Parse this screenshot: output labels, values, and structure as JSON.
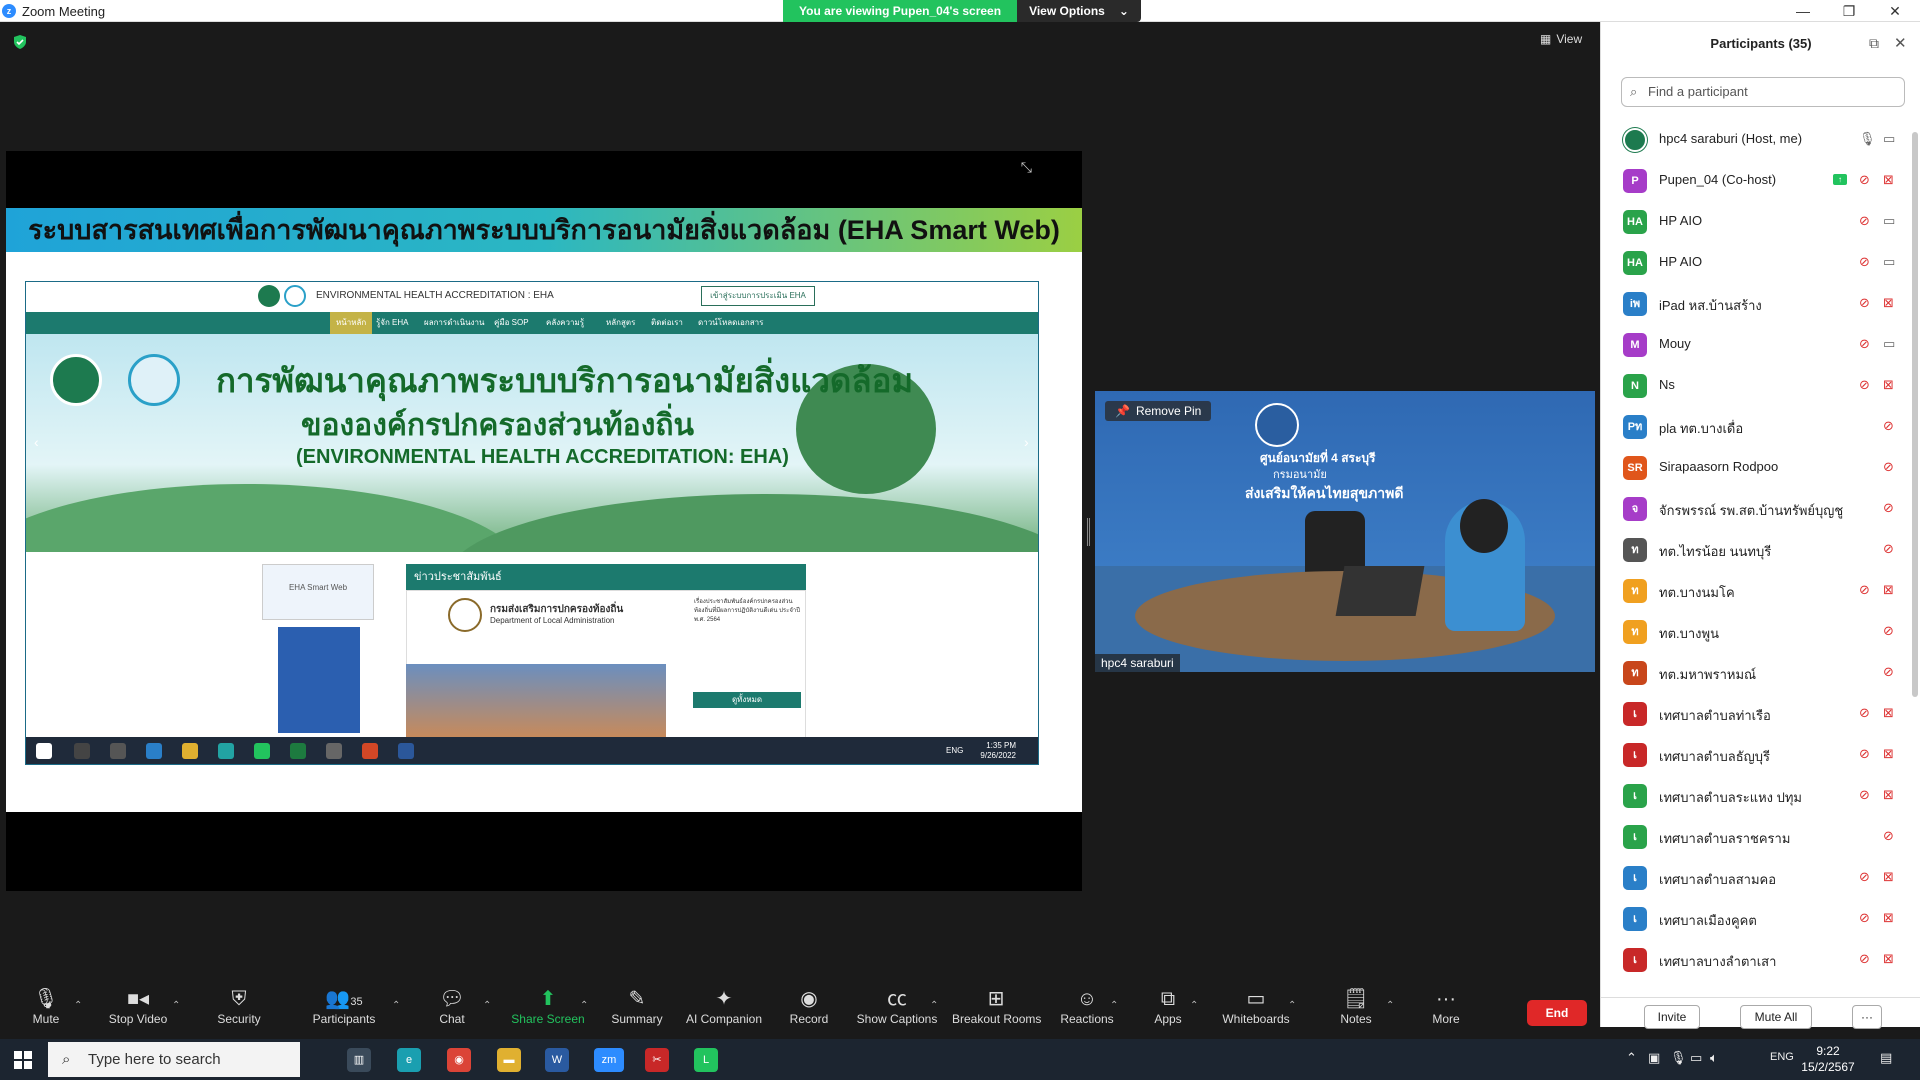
{
  "window": {
    "title": "Zoom Meeting",
    "share_banner": "You are viewing Pupen_04's screen",
    "view_options": "View Options"
  },
  "meeting": {
    "view_label": "View"
  },
  "slide": {
    "title": "ระบบสารสนเทศเพื่อการพัฒนาคุณภาพระบบบริการอนามัยสิ่งแวดล้อม (EHA Smart Web)",
    "site_header": "ENVIRONMENTAL HEALTH ACCREDITATION : EHA",
    "login_button": "เข้าสู่ระบบการประเมิน EHA",
    "nav": [
      "หน้าหลัก",
      "รู้จัก EHA",
      "ผลการดำเนินงาน",
      "คู่มือ SOP",
      "คลังความรู้",
      "หลักสูตร",
      "ติดต่อเรา",
      "ดาวน์โหลดเอกสาร"
    ],
    "banner_line1": "การพัฒนาคุณภาพระบบบริการอนามัยสิ่งแวดล้อม",
    "banner_line2": "ขององค์กรปกครองส่วนท้องถิ่น",
    "banner_line3": "(ENVIRONMENTAL HEALTH ACCREDITATION: EHA)",
    "news_header": "ข่าวประชาสัมพันธ์",
    "news_org_th": "กรมส่งเสริมการปกครองท้องถิ่น",
    "news_org_en": "Department of Local Administration",
    "news_text": "เรื่องประชาสัมพันธ์องค์กรปกครองส่วนท้องถิ่นที่มีผลการปฏิบัติงานดีเด่น ประจำปี พ.ศ. 2564",
    "all_button": "ดูทั้งหมด",
    "eha_smart_web": "EHA Smart Web",
    "taskbar_lang": "ENG",
    "taskbar_time": "1:35 PM",
    "taskbar_date": "9/26/2022"
  },
  "video": {
    "remove_pin": "Remove Pin",
    "name": "hpc4 saraburi",
    "wall_line1": "ศูนย์อนามัยที่ 4 สระบุรี",
    "wall_line2": "กรมอนามัย",
    "wall_line3": "ส่งเสริมให้คนไทยสุขภาพดี"
  },
  "participants": {
    "title": "Participants (35)",
    "search_placeholder": "Find a participant",
    "invite": "Invite",
    "mute_all": "Mute All",
    "more": "···",
    "list": [
      {
        "initials": "",
        "name": "hpc4 saraburi (Host, me)",
        "color": "#1d7a4f",
        "mic": "on",
        "cam": "on"
      },
      {
        "initials": "P",
        "name": "Pupen_04 (Co-host)",
        "color": "#a63cc8",
        "mic": "off",
        "cam": "off",
        "sharing": true
      },
      {
        "initials": "HA",
        "name": "HP AIO",
        "color": "#2aa34a",
        "mic": "off",
        "cam": "on"
      },
      {
        "initials": "HA",
        "name": "HP AIO",
        "color": "#2aa34a",
        "mic": "off",
        "cam": "on"
      },
      {
        "initials": "iพ",
        "name": "iPad หส.บ้านสร้าง",
        "color": "#2a7fc8",
        "mic": "off",
        "cam": "off"
      },
      {
        "initials": "M",
        "name": "Mouy",
        "color": "#a63cc8",
        "mic": "off",
        "cam": "on"
      },
      {
        "initials": "N",
        "name": "Ns",
        "color": "#2aa34a",
        "mic": "off",
        "cam": "off"
      },
      {
        "initials": "Pท",
        "name": "pla ทต.บางเดื่อ",
        "color": "#2a7fc8",
        "mic": "off",
        "cam": ""
      },
      {
        "initials": "SR",
        "name": "Sirapaasorn Rodpoo",
        "color": "#e0561b",
        "mic": "off",
        "cam": ""
      },
      {
        "initials": "จ",
        "name": "จักรพรรณ์ รพ.สต.บ้านทรัพย์บุญชู",
        "color": "#a63cc8",
        "mic": "off",
        "cam": ""
      },
      {
        "initials": "ท",
        "name": "ทต.ไทรน้อย นนทบุรี",
        "color": "#555555",
        "mic": "off",
        "cam": ""
      },
      {
        "initials": "ท",
        "name": "ทต.บางนมโค",
        "color": "#f0a020",
        "mic": "off",
        "cam": "off"
      },
      {
        "initials": "ท",
        "name": "ทต.บางพูน",
        "color": "#f0a020",
        "mic": "off",
        "cam": ""
      },
      {
        "initials": "ท",
        "name": "ทต.มหาพราหมณ์",
        "color": "#c8461b",
        "mic": "off",
        "cam": ""
      },
      {
        "initials": "เ",
        "name": "เทศบาลตำบลท่าเรือ",
        "color": "#c82828",
        "mic": "off",
        "cam": "off"
      },
      {
        "initials": "เ",
        "name": "เทศบาลตำบลธัญบุรี",
        "color": "#c82828",
        "mic": "off",
        "cam": "off"
      },
      {
        "initials": "เ",
        "name": "เทศบาลตำบลระแหง ปทุม",
        "color": "#2aa34a",
        "mic": "off",
        "cam": "off"
      },
      {
        "initials": "เ",
        "name": "เทศบาลตำบลราชคราม",
        "color": "#2aa34a",
        "mic": "off",
        "cam": ""
      },
      {
        "initials": "เ",
        "name": "เทศบาลตำบลสามคอ",
        "color": "#2a7fc8",
        "mic": "off",
        "cam": "off"
      },
      {
        "initials": "เ",
        "name": "เทศบาลเมืองคูคต",
        "color": "#2a7fc8",
        "mic": "off",
        "cam": "off"
      },
      {
        "initials": "เ",
        "name": "เทศบาลบางลำตาเสา",
        "color": "#c82828",
        "mic": "off",
        "cam": "off"
      }
    ]
  },
  "toolbar": {
    "mute": "Mute",
    "stop_video": "Stop Video",
    "security": "Security",
    "participants": "Participants",
    "participant_count": "35",
    "chat": "Chat",
    "share_screen": "Share Screen",
    "summary": "Summary",
    "ai_companion": "AI Companion",
    "record": "Record",
    "show_captions": "Show Captions",
    "breakout_rooms": "Breakout Rooms",
    "reactions": "Reactions",
    "apps": "Apps",
    "whiteboards": "Whiteboards",
    "notes": "Notes",
    "more": "More",
    "end": "End"
  },
  "taskbar": {
    "search_placeholder": "Type here to search",
    "lang": "ENG",
    "time": "9:22",
    "date": "15/2/2567"
  }
}
